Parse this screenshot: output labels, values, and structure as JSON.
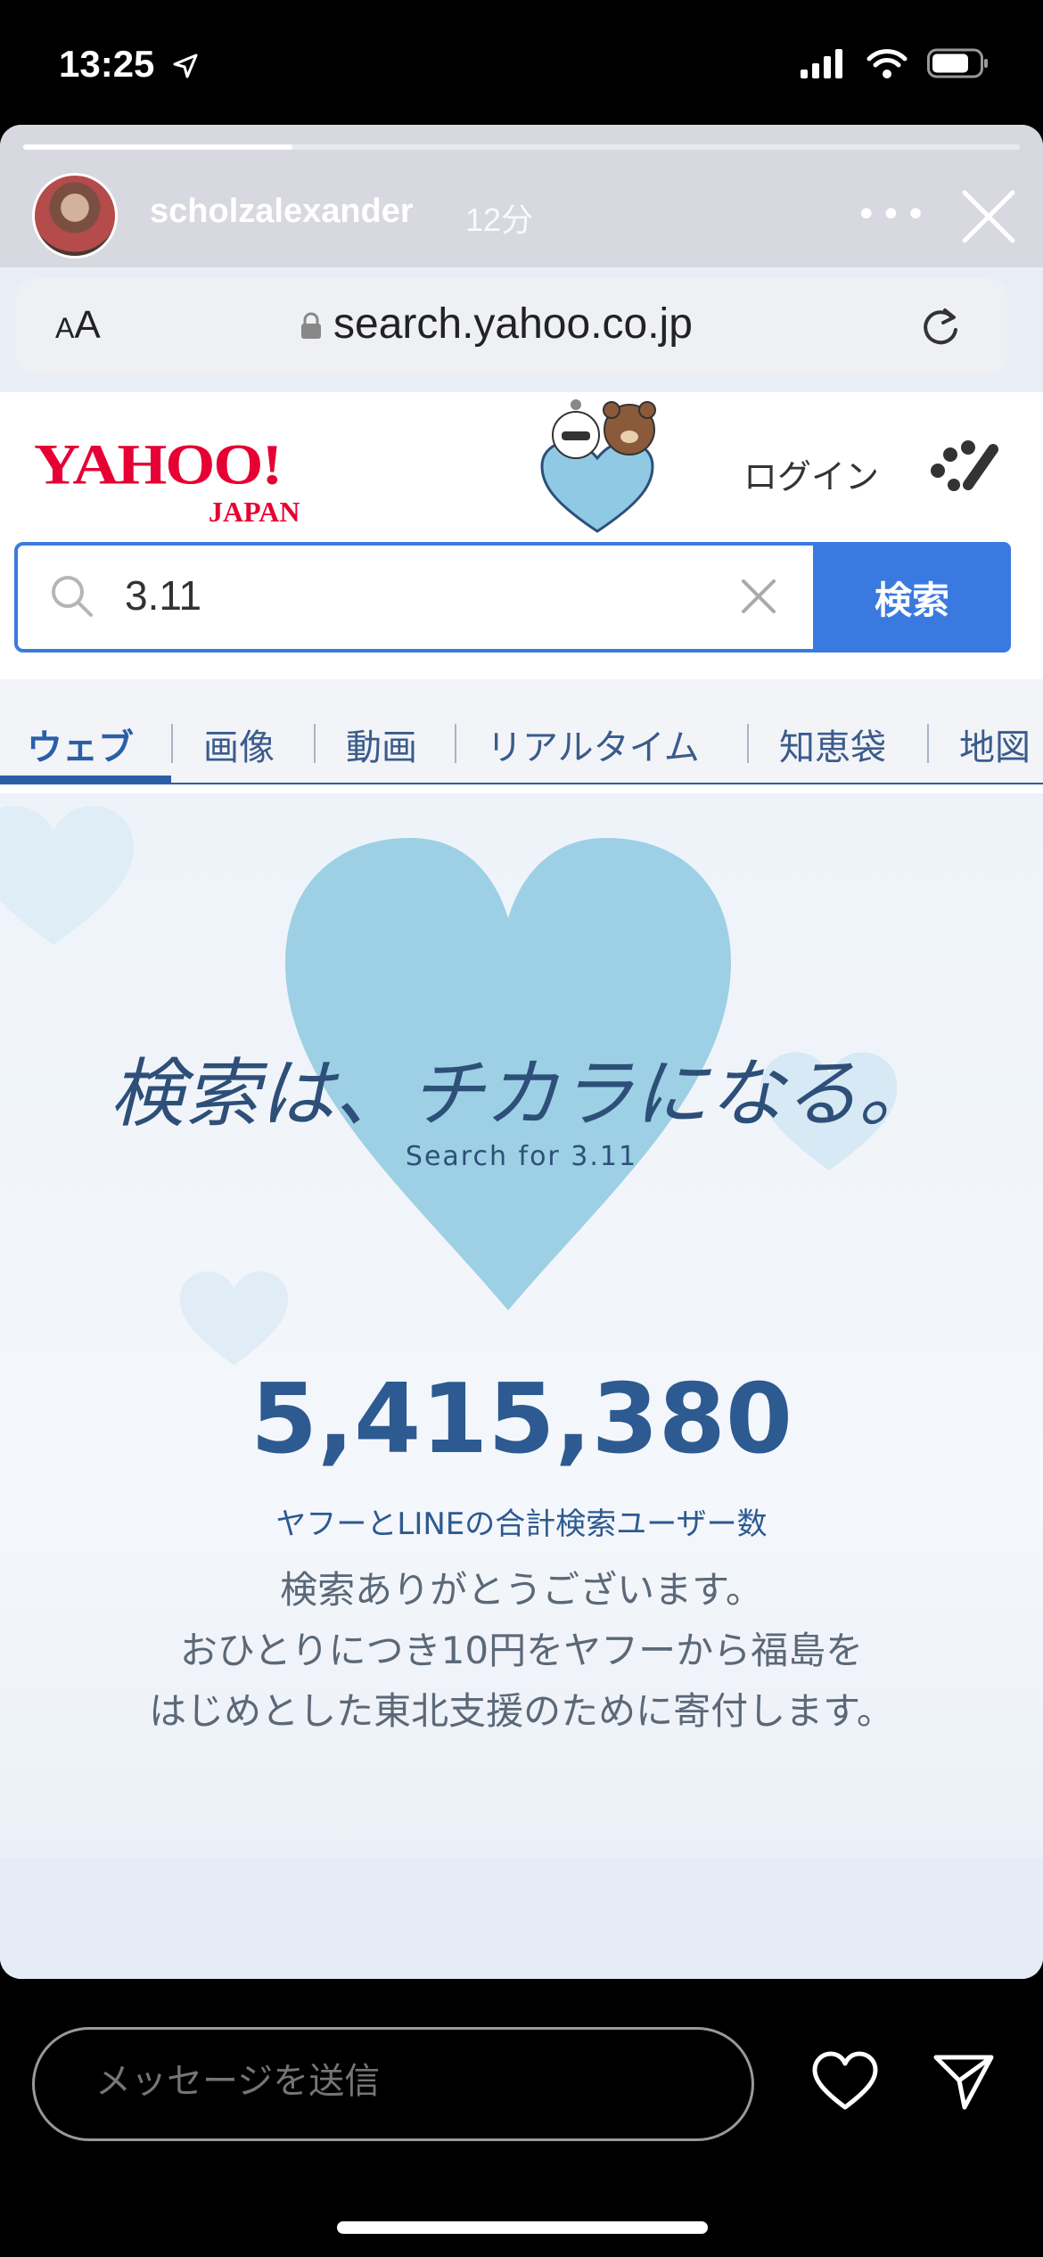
{
  "status_bar": {
    "time": "13:25",
    "icons": [
      "location-arrow-icon",
      "cellular-signal-icon",
      "wifi-icon",
      "battery-icon"
    ]
  },
  "story": {
    "progress": 0.27,
    "username": "scholzalexander",
    "time_ago": "12分",
    "more_label": "•••"
  },
  "browser": {
    "text_size_label": "AA",
    "url": "search.yahoo.co.jp"
  },
  "yahoo": {
    "logo_main": "YAHOO!",
    "logo_sub": "JAPAN",
    "login_label": "ログイン",
    "search_value": "3.11",
    "search_button": "検索",
    "tabs": [
      "ウェブ",
      "画像",
      "動画",
      "リアルタイム",
      "知恵袋",
      "地図"
    ],
    "active_tab": "ウェブ",
    "slogan": "検索は、チカラになる。",
    "slogan_en": "Search for 3.11",
    "counter": "5,415,380",
    "counter_label": "ヤフーとLINEの合計検索ユーザー数",
    "thanks_lines": [
      "検索ありがとうございます。",
      "おひとりにつき10円をヤフーから福島を",
      "はじめとした東北支援のために寄付します。"
    ]
  },
  "footer": {
    "message_placeholder": "メッセージを送信"
  },
  "colors": {
    "yahoo_red": "#e60033",
    "search_blue": "#3a7ae0",
    "heart_blue": "#9dd0e4",
    "text_navy": "#2d5a90"
  }
}
